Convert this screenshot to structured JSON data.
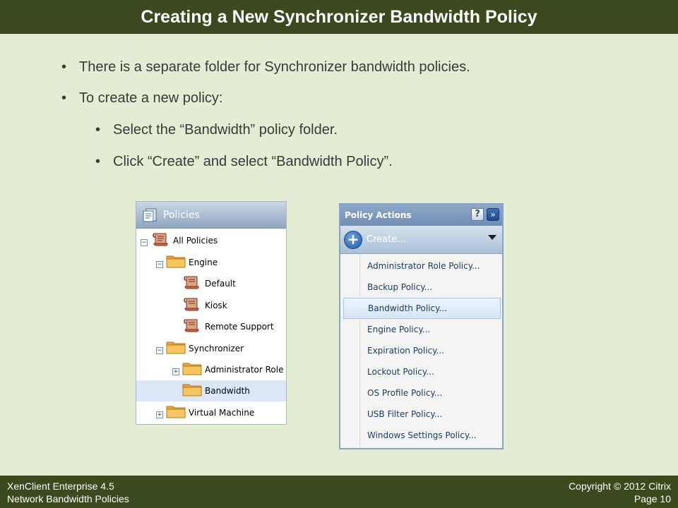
{
  "slide": {
    "title": "Creating a New Synchronizer Bandwidth Policy",
    "bullets": [
      "There is a separate folder for Synchronizer bandwidth policies.",
      "To create a new policy:",
      "Select the “Bandwidth” policy folder.",
      "Click “Create” and select “Bandwidth Policy”."
    ],
    "bullet_glyph": "•"
  },
  "tree": {
    "header": "Policies",
    "header_icon": "policies-icon",
    "items": [
      {
        "label": "All Policies",
        "icon": "policy-scroll-icon",
        "expander": "minus"
      },
      {
        "label": "Engine",
        "icon": "folder-icon",
        "expander": "minus"
      },
      {
        "label": "Default",
        "icon": "policy-scroll-icon",
        "expander": ""
      },
      {
        "label": "Kiosk",
        "icon": "policy-scroll-icon",
        "expander": ""
      },
      {
        "label": "Remote Support",
        "icon": "policy-scroll-icon",
        "expander": ""
      },
      {
        "label": "Synchronizer",
        "icon": "folder-icon",
        "expander": "minus"
      },
      {
        "label": "Administrator Role",
        "icon": "folder-icon",
        "expander": "plus"
      },
      {
        "label": "Bandwidth",
        "icon": "folder-icon",
        "expander": "",
        "selected": true
      },
      {
        "label": "Virtual Machine",
        "icon": "folder-icon",
        "expander": "plus"
      }
    ]
  },
  "actions": {
    "header": "Policy Actions",
    "help_glyph": "?",
    "collapse_glyph": "»",
    "create_glyph": "+",
    "create_label": "Create...",
    "menu": [
      "Administrator Role Policy...",
      "Backup Policy...",
      "Bandwidth Policy...",
      "Engine Policy...",
      "Expiration Policy...",
      "Lockout Policy...",
      "OS Profile Policy...",
      "USB Filter Policy...",
      "Windows Settings Policy..."
    ],
    "highlighted_index": 2
  },
  "footer": {
    "left_line1": "XenClient Enterprise 4.5",
    "left_line2": "Network Bandwidth Policies",
    "right_line1": "Copyright © 2012 Citrix",
    "right_line2": "Page 10"
  },
  "colors": {
    "background": "#e2edd4",
    "bar": "#3b4a1e",
    "selection": "#dbe7f7"
  }
}
